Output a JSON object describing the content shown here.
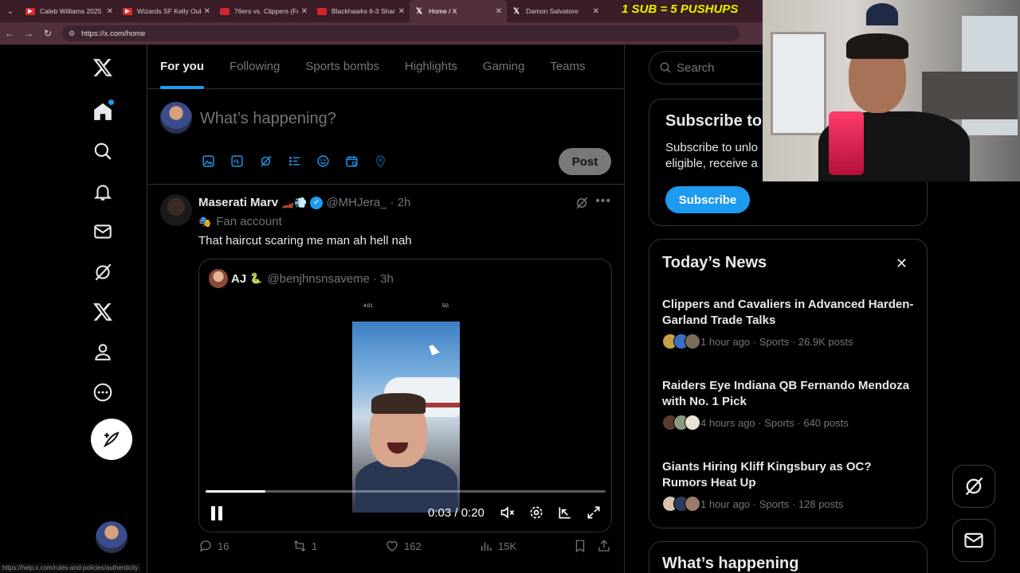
{
  "browser": {
    "tabs": [
      {
        "title": "Caleb Williams 2025",
        "favicon": "youtube-icon",
        "active": false
      },
      {
        "title": "Wizards SF Kelly Oub",
        "favicon": "youtube-icon",
        "active": false
      },
      {
        "title": "76ers vs. Clippers (Fe",
        "favicon": "news-icon",
        "active": false
      },
      {
        "title": "Blackhawks 6-3 Shar",
        "favicon": "news-icon",
        "active": false
      },
      {
        "title": "Home / X",
        "favicon": "x-icon",
        "active": true
      },
      {
        "title": "Damon Salvatore",
        "favicon": "x-icon",
        "active": false
      }
    ],
    "url": "https://x.com/home",
    "status_url": "https://help.x.com/rules-and-policies/authenticity"
  },
  "overlay": {
    "banner": "1 SUB = 5 PUSHUPS"
  },
  "feed": {
    "tabs": [
      "For you",
      "Following",
      "Sports bombs",
      "Highlights",
      "Gaming",
      "Teams"
    ],
    "active_tab": "For you",
    "composer": {
      "placeholder": "What’s happening?",
      "post_label": "Post"
    }
  },
  "tweet": {
    "name": "Maserati Marv",
    "name_emoji": "🏎️💨",
    "handle": "@MHJera_",
    "time": "· 2h",
    "label": "Fan account",
    "text": "That haircut scaring me man ah hell nah",
    "quote": {
      "name": "AJ",
      "name_emoji": "🐍",
      "handle": "@benjhnsnsaveme",
      "time": "· 3h",
      "video": {
        "status_time": "4:01",
        "status_signal": "5G",
        "current_time": "0:03",
        "duration": "0:20",
        "time_display": "0:03 / 0:20",
        "progress": 0.15
      }
    },
    "stats": {
      "replies": "16",
      "reposts": "1",
      "likes": "162",
      "views": "15K"
    }
  },
  "sidebar": {
    "search_placeholder": "Search",
    "subscribe": {
      "title": "Subscribe to",
      "desc_line1": "Subscribe to unlo",
      "desc_line2": "eligible, receive a",
      "button": "Subscribe"
    },
    "news": {
      "title": "Today’s News",
      "items": [
        {
          "headline": "Clippers and Cavaliers in Advanced Harden-Garland Trade Talks",
          "meta": "1 hour ago · Sports · 26.9K posts"
        },
        {
          "headline": "Raiders Eye Indiana QB Fernando Mendoza with No. 1 Pick",
          "meta": "4 hours ago · Sports · 640 posts"
        },
        {
          "headline": "Giants Hiring Kliff Kingsbury as OC? Rumors Heat Up",
          "meta": "1 hour ago · Sports · 128 posts"
        }
      ]
    },
    "happening_title": "What’s happening"
  },
  "colors": {
    "accent": "#1d9bf0",
    "background": "#000000",
    "muted_text": "#71767b",
    "border": "#2f3336"
  }
}
